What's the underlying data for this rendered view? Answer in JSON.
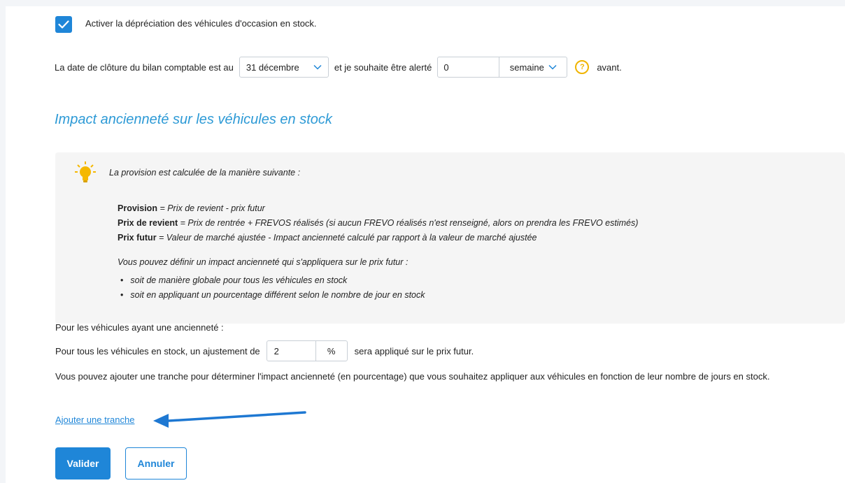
{
  "depreciation": {
    "checked": true,
    "label": "Activer la dépréciation des véhicules d'occasion en stock."
  },
  "closing": {
    "text_before": "La date de clôture du bilan comptable est au",
    "date_value": "31 décembre",
    "text_middle": "et je souhaite être alerté",
    "alert_value": "0",
    "unit_value": "semaine",
    "help_glyph": "?",
    "text_after": "avant."
  },
  "section_title": "Impact ancienneté sur les véhicules en stock",
  "info": {
    "intro": "La provision est calculée de la manière suivante :",
    "provision_label": "Provision",
    "provision_formula": " = Prix de revient - prix futur",
    "cost_label": "Prix de revient",
    "cost_formula": " = Prix de rentrée + FREVOS réalisés (si aucun FREVO réalisés n'est renseigné, alors on prendra les FREVO estimés)",
    "future_label": "Prix futur",
    "future_formula": " = Valeur de marché ajustée - Impact ancienneté calculé par rapport à la valeur de marché ajustée",
    "can_define": "Vous pouvez définir un impact ancienneté qui s'appliquera sur le prix futur :",
    "bullet1": "soit de manière globale pour tous les véhicules en stock",
    "bullet2": "soit en appliquant un pourcentage différent selon le nombre de jour en stock"
  },
  "seniority_intro": "Pour les véhicules ayant une ancienneté :",
  "adjustment": {
    "text_before": "Pour tous les véhicules en stock, un ajustement de",
    "value": "2",
    "unit": "%",
    "text_after": "sera appliqué sur le prix futur."
  },
  "tranche_text": "Vous pouvez ajouter une tranche pour déterminer l'impact ancienneté (en pourcentage) que vous souhaitez appliquer aux véhicules en fonction de leur nombre de jours en stock.",
  "add_tranche_link": "Ajouter une tranche",
  "buttons": {
    "validate": "Valider",
    "cancel": "Annuler"
  },
  "colors": {
    "accent": "#1f86d8",
    "title": "#2d9ad6",
    "help": "#f0b400",
    "annotation_arrow": "#1e78d2"
  },
  "icons": [
    "check-icon",
    "chevron-down-icon",
    "help-circle-icon",
    "lightbulb-icon",
    "annotation-arrow"
  ]
}
